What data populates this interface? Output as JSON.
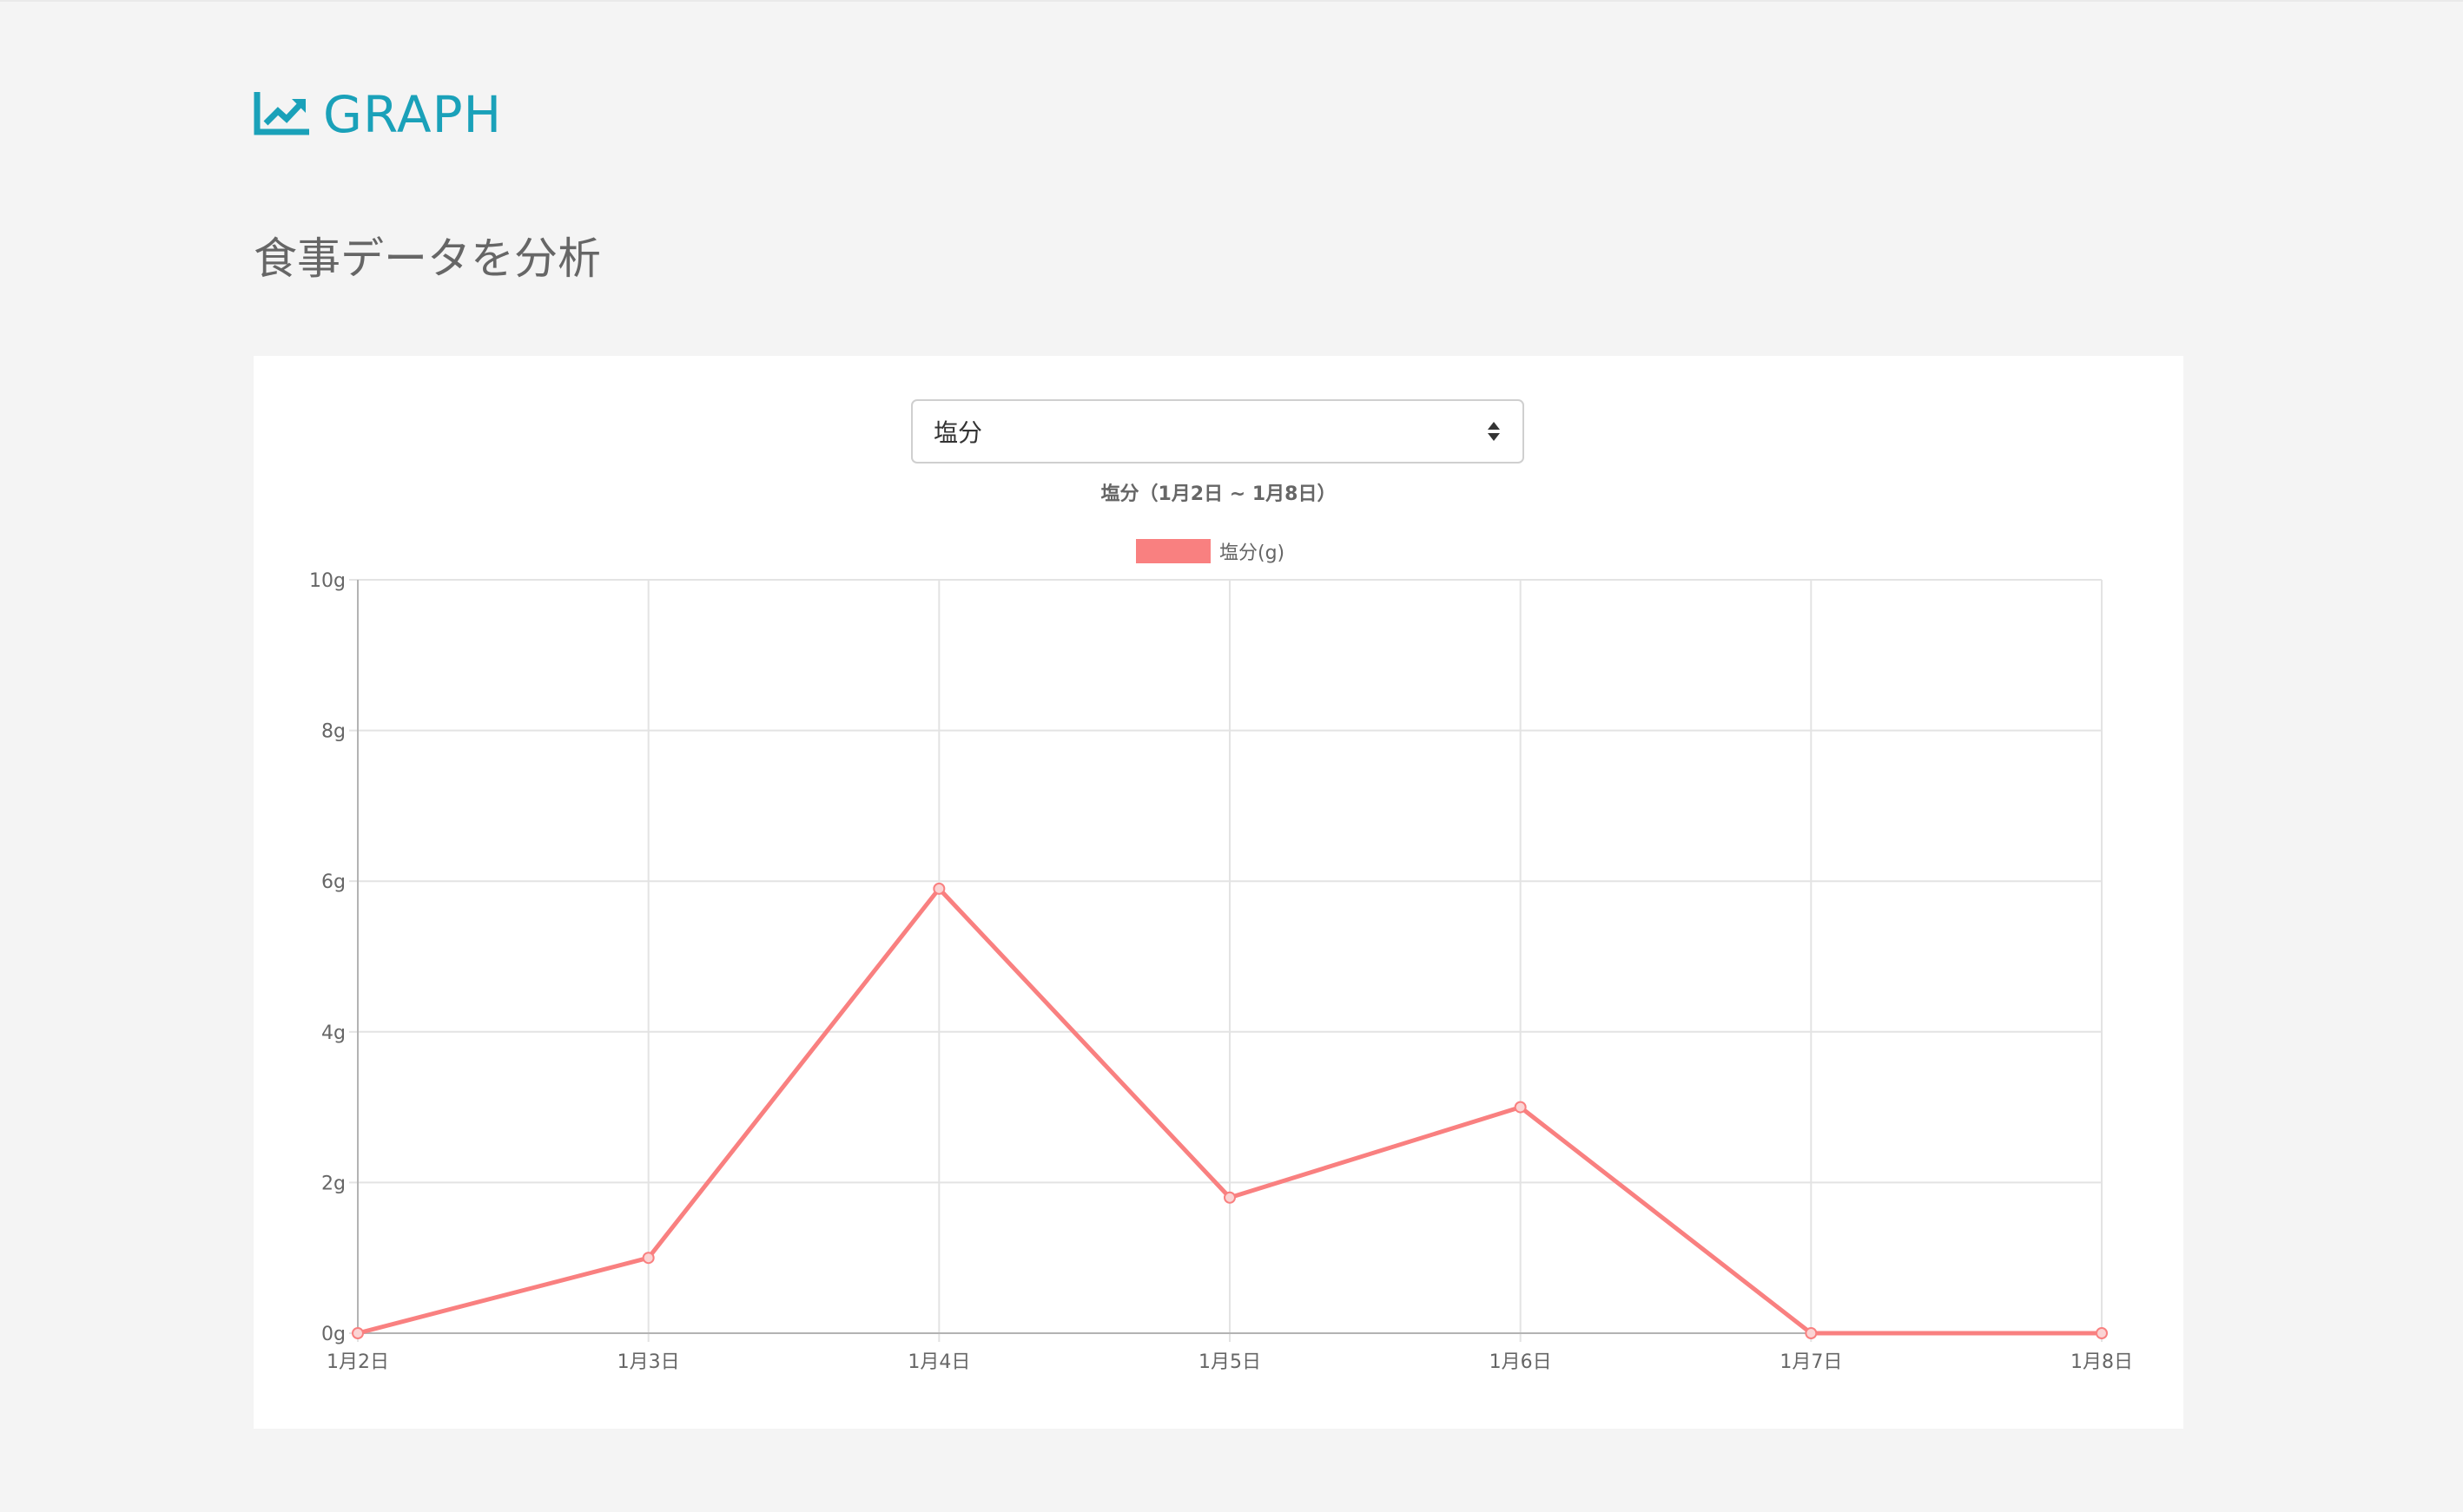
{
  "header": {
    "brand_icon": "line-chart-icon",
    "brand_text": "GRAPH",
    "brand_color": "#1aa1b9"
  },
  "page": {
    "title": "食事データを分析"
  },
  "filter": {
    "selected": "塩分",
    "caret_icon": "sort-arrows-icon"
  },
  "chart_data": {
    "type": "line",
    "title": "塩分（1月2日 ~ 1月8日）",
    "categories": [
      "1月2日",
      "1月3日",
      "1月4日",
      "1月5日",
      "1月6日",
      "1月7日",
      "1月8日"
    ],
    "series": [
      {
        "name": "塩分(g)",
        "values": [
          0,
          1,
          5.9,
          1.8,
          3,
          0,
          0
        ],
        "color": "#f98080"
      }
    ],
    "ylim": [
      0,
      10
    ],
    "yticks": [
      "0g",
      "2g",
      "4g",
      "6g",
      "8g",
      "10g"
    ],
    "xlabel": "",
    "ylabel": "",
    "grid": true,
    "legend": "top-center"
  }
}
